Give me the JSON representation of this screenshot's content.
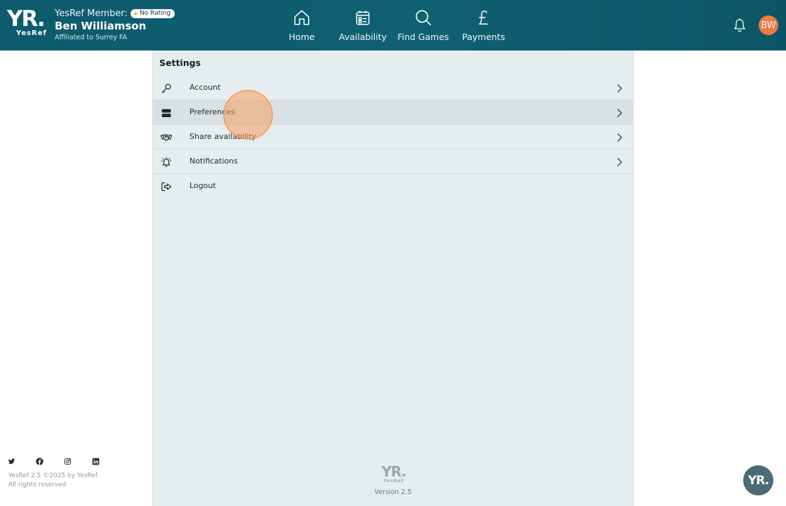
{
  "header": {
    "logo_mark": "YR.",
    "logo_word": "YesRef",
    "member_label": "YesRef Member:",
    "rating_badge": "No Rating",
    "member_name": "Ben Williamson",
    "affiliation": "Affiliated to Surrey FA",
    "avatar_initials": "BW"
  },
  "nav": [
    {
      "label": "Home",
      "icon": "home-icon"
    },
    {
      "label": "Availability",
      "icon": "calendar-icon"
    },
    {
      "label": "Find Games",
      "icon": "search-icon"
    },
    {
      "label": "Payments",
      "icon": "pound-icon"
    }
  ],
  "settings": {
    "title": "Settings",
    "items": [
      {
        "label": "Account",
        "icon": "key-icon",
        "chevron": true
      },
      {
        "label": "Preferences",
        "icon": "preferences-icon",
        "chevron": true
      },
      {
        "label": "Share availability",
        "icon": "handshake-icon",
        "chevron": true
      },
      {
        "label": "Notifications",
        "icon": "alarm-bell-icon",
        "chevron": true
      },
      {
        "label": "Logout",
        "icon": "logout-icon",
        "chevron": false
      }
    ]
  },
  "footer": {
    "version_logo": "YR.",
    "version_word": "YesRef",
    "version": "Version 2.5",
    "copyright_line1": "YesRef 2.5 ©2025 by YesRef.",
    "copyright_line2": "All rights reserved",
    "social": [
      "twitter-icon",
      "facebook-icon",
      "instagram-icon",
      "linkedin-icon"
    ],
    "fab_label": "YR."
  },
  "colors": {
    "header_bg": "#0f6072",
    "panel_bg": "#e6edef",
    "avatar_bg": "#ee7a43",
    "click_indicator": "#f89e5c"
  }
}
